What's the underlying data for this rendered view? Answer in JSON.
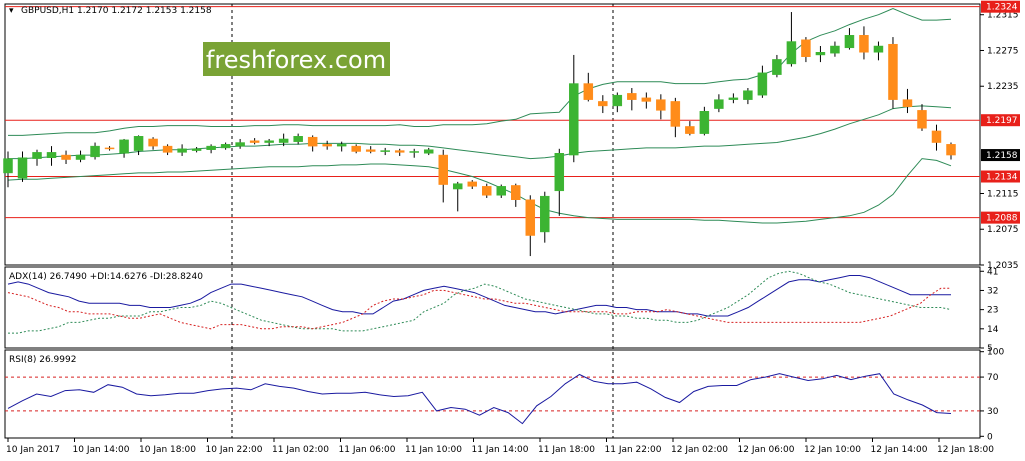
{
  "header": {
    "symbol_info": "GBPUSD,H1  1.2170 1.2172 1.2153 1.2158",
    "adx_info": "ADX(14) 26.7490 +DI:14.6276 -DI:28.8240",
    "rsi_info": "RSI(8) 26.9992"
  },
  "watermark": "freshforex.com",
  "colors": {
    "bull": "#3cb432",
    "bear": "#ff8c1a",
    "band": "#2e8b57",
    "level": "#e8201a",
    "adx": "#1a1aa0",
    "plus_di": "#2e8b57",
    "minus_di": "#d62020",
    "rsi": "#1a1aa0",
    "rsi_level": "#d62020",
    "current_tag": "#000000"
  },
  "chart_data": [
    {
      "type": "candlestick",
      "ylim": [
        1.2035,
        1.2327
      ],
      "y_ticks": [
        "1.2315",
        "1.2275",
        "1.2235",
        "1.2197",
        "1.2158",
        "1.2134",
        "1.2115",
        "1.2088",
        "1.2075",
        "1.2035"
      ],
      "price_tags": [
        {
          "value": "1.2324",
          "color": "level"
        },
        {
          "value": "1.2197",
          "color": "level"
        },
        {
          "value": "1.2158",
          "color": "current"
        },
        {
          "value": "1.2134",
          "color": "level"
        },
        {
          "value": "1.2088",
          "color": "level"
        }
      ],
      "levels": [
        1.2324,
        1.2197,
        1.2134,
        1.2088
      ],
      "current": 1.2158,
      "candles": [
        [
          1.2138,
          1.2162,
          1.2122,
          1.2154
        ],
        [
          1.2132,
          1.2162,
          1.2128,
          1.2155
        ],
        [
          1.2154,
          1.2164,
          1.2146,
          1.2161
        ],
        [
          1.2155,
          1.2168,
          1.2146,
          1.2161
        ],
        [
          1.2158,
          1.2163,
          1.2148,
          1.2153
        ],
        [
          1.2153,
          1.2163,
          1.215,
          1.2158
        ],
        [
          1.2156,
          1.2172,
          1.2153,
          1.2168
        ],
        [
          1.2166,
          1.2168,
          1.2163,
          1.2165
        ],
        [
          1.216,
          1.2176,
          1.2155,
          1.2175
        ],
        [
          1.2163,
          1.218,
          1.2158,
          1.2179
        ],
        [
          1.2176,
          1.2178,
          1.2164,
          1.2168
        ],
        [
          1.2168,
          1.217,
          1.2158,
          1.2161
        ],
        [
          1.2161,
          1.217,
          1.2157,
          1.2165
        ],
        [
          1.2163,
          1.2167,
          1.2161,
          1.2165
        ],
        [
          1.2164,
          1.217,
          1.216,
          1.2168
        ],
        [
          1.2166,
          1.2172,
          1.2164,
          1.217
        ],
        [
          1.2168,
          1.2176,
          1.2165,
          1.2172
        ],
        [
          1.2174,
          1.2177,
          1.217,
          1.2172
        ],
        [
          1.2172,
          1.2176,
          1.2168,
          1.2174
        ],
        [
          1.2172,
          1.2182,
          1.2168,
          1.2176
        ],
        [
          1.2173,
          1.2182,
          1.217,
          1.2179
        ],
        [
          1.2178,
          1.218,
          1.2162,
          1.2168
        ],
        [
          1.217,
          1.2174,
          1.2164,
          1.2168
        ],
        [
          1.2168,
          1.2173,
          1.2162,
          1.217
        ],
        [
          1.2168,
          1.217,
          1.216,
          1.2162
        ],
        [
          1.2164,
          1.2168,
          1.216,
          1.2162
        ],
        [
          1.2162,
          1.2166,
          1.2158,
          1.2163
        ],
        [
          1.2163,
          1.2165,
          1.2157,
          1.2161
        ],
        [
          1.2161,
          1.2165,
          1.2155,
          1.2162
        ],
        [
          1.216,
          1.2166,
          1.2158,
          1.2164
        ],
        [
          1.2158,
          1.2164,
          1.2105,
          1.2125
        ],
        [
          1.212,
          1.2128,
          1.2095,
          1.2126
        ],
        [
          1.2128,
          1.213,
          1.212,
          1.2123
        ],
        [
          1.2123,
          1.2126,
          1.211,
          1.2113
        ],
        [
          1.2113,
          1.2125,
          1.211,
          1.2123
        ],
        [
          1.2124,
          1.2126,
          1.21,
          1.2108
        ],
        [
          1.2108,
          1.2113,
          1.2045,
          1.2068
        ],
        [
          1.2072,
          1.2117,
          1.206,
          1.2112
        ],
        [
          1.2118,
          1.2165,
          1.209,
          1.216
        ],
        [
          1.2158,
          1.227,
          1.215,
          1.2238
        ],
        [
          1.2238,
          1.225,
          1.2218,
          1.222
        ],
        [
          1.2218,
          1.2225,
          1.2205,
          1.2213
        ],
        [
          1.2213,
          1.2228,
          1.2206,
          1.2225
        ],
        [
          1.2227,
          1.2233,
          1.2208,
          1.222
        ],
        [
          1.2222,
          1.2228,
          1.221,
          1.2218
        ],
        [
          1.222,
          1.2226,
          1.2198,
          1.2208
        ],
        [
          1.2218,
          1.2222,
          1.2178,
          1.219
        ],
        [
          1.219,
          1.2196,
          1.218,
          1.2182
        ],
        [
          1.2182,
          1.2212,
          1.218,
          1.2207
        ],
        [
          1.221,
          1.2226,
          1.2206,
          1.222
        ],
        [
          1.222,
          1.2227,
          1.2216,
          1.2222
        ],
        [
          1.222,
          1.2233,
          1.2215,
          1.223
        ],
        [
          1.2225,
          1.2258,
          1.2222,
          1.225
        ],
        [
          1.2248,
          1.227,
          1.2245,
          1.2265
        ],
        [
          1.226,
          1.2318,
          1.2257,
          1.2285
        ],
        [
          1.2287,
          1.229,
          1.2262,
          1.2268
        ],
        [
          1.227,
          1.228,
          1.2262,
          1.2273
        ],
        [
          1.2272,
          1.2285,
          1.2268,
          1.228
        ],
        [
          1.2278,
          1.23,
          1.2276,
          1.2292
        ],
        [
          1.2292,
          1.2302,
          1.2265,
          1.2273
        ],
        [
          1.2273,
          1.2285,
          1.2264,
          1.228
        ],
        [
          1.2282,
          1.229,
          1.221,
          1.222
        ],
        [
          1.222,
          1.2232,
          1.2205,
          1.2212
        ],
        [
          1.2208,
          1.2215,
          1.2185,
          1.2188
        ],
        [
          1.2185,
          1.2192,
          1.2163,
          1.2172
        ],
        [
          1.217,
          1.2172,
          1.2153,
          1.2158
        ]
      ],
      "bb_upper": [
        1.218,
        1.218,
        1.2181,
        1.2182,
        1.2183,
        1.2183,
        1.2183,
        1.2185,
        1.2188,
        1.219,
        1.219,
        1.2191,
        1.2191,
        1.2191,
        1.219,
        1.219,
        1.219,
        1.2191,
        1.2191,
        1.2192,
        1.2192,
        1.2191,
        1.2191,
        1.2191,
        1.2191,
        1.2191,
        1.2191,
        1.2192,
        1.219,
        1.219,
        1.2192,
        1.2192,
        1.2192,
        1.2193,
        1.2196,
        1.2198,
        1.2204,
        1.2205,
        1.2206,
        1.2224,
        1.2232,
        1.2237,
        1.224,
        1.224,
        1.224,
        1.224,
        1.2238,
        1.2238,
        1.2238,
        1.224,
        1.2242,
        1.2243,
        1.2248,
        1.2254,
        1.2272,
        1.2285,
        1.2292,
        1.2297,
        1.2304,
        1.231,
        1.2315,
        1.2322,
        1.2315,
        1.2309,
        1.2309,
        1.231
      ],
      "bb_middle": [
        1.2154,
        1.2154,
        1.2155,
        1.2156,
        1.2157,
        1.2158,
        1.2158,
        1.2159,
        1.216,
        1.2162,
        1.2163,
        1.2164,
        1.2164,
        1.2165,
        1.2166,
        1.2167,
        1.2168,
        1.2168,
        1.2169,
        1.217,
        1.217,
        1.2171,
        1.2171,
        1.2171,
        1.2171,
        1.217,
        1.217,
        1.2169,
        1.2169,
        1.2168,
        1.2166,
        1.2164,
        1.2162,
        1.216,
        1.2158,
        1.2156,
        1.2154,
        1.2155,
        1.2157,
        1.216,
        1.2162,
        1.2163,
        1.2164,
        1.2165,
        1.2166,
        1.2166,
        1.2166,
        1.2167,
        1.2168,
        1.2168,
        1.2169,
        1.217,
        1.2171,
        1.2172,
        1.2175,
        1.2178,
        1.2182,
        1.2187,
        1.2193,
        1.2198,
        1.2203,
        1.221,
        1.2212,
        1.2213,
        1.2212,
        1.2211
      ],
      "bb_lower": [
        1.213,
        1.2131,
        1.2131,
        1.2132,
        1.2133,
        1.2134,
        1.2135,
        1.2136,
        1.2137,
        1.2138,
        1.2138,
        1.2139,
        1.2139,
        1.214,
        1.2141,
        1.2142,
        1.2143,
        1.2144,
        1.2145,
        1.2145,
        1.2145,
        1.2146,
        1.2146,
        1.2147,
        1.2147,
        1.2148,
        1.2148,
        1.2147,
        1.2146,
        1.2145,
        1.2142,
        1.2138,
        1.2134,
        1.2128,
        1.2121,
        1.2114,
        1.2105,
        1.2097,
        1.2093,
        1.209,
        1.2088,
        1.2087,
        1.2086,
        1.2086,
        1.2086,
        1.2086,
        1.2086,
        1.2086,
        1.2085,
        1.2085,
        1.2084,
        1.2083,
        1.2082,
        1.2082,
        1.2083,
        1.2084,
        1.2086,
        1.2088,
        1.209,
        1.2094,
        1.2102,
        1.2114,
        1.2135,
        1.2154,
        1.2152,
        1.2146
      ]
    },
    {
      "type": "line",
      "ylim": [
        5,
        43
      ],
      "y_ticks": [
        "41",
        "32",
        "23",
        "14",
        "5"
      ],
      "series": [
        {
          "name": "ADX",
          "values": [
            35,
            36,
            35,
            33,
            31,
            30,
            29,
            27,
            26,
            26,
            26,
            26,
            25,
            25,
            24,
            24,
            24,
            25,
            26,
            28,
            31,
            33,
            35,
            35,
            34,
            33,
            32,
            31,
            30,
            29,
            27,
            25,
            23,
            22,
            22,
            21,
            21,
            24,
            27,
            28,
            30,
            32,
            33,
            34,
            33,
            32,
            31,
            29,
            27,
            25,
            24,
            23,
            22,
            22,
            21,
            22,
            23,
            24,
            25,
            25,
            24,
            24,
            23,
            23,
            22,
            22,
            22,
            21,
            21,
            20,
            20,
            20,
            22,
            24,
            27,
            30,
            33,
            36,
            37,
            37,
            36,
            37,
            38,
            39,
            39,
            38,
            36,
            34,
            32,
            30,
            30,
            30,
            30,
            30
          ]
        },
        {
          "name": "+DI",
          "values": [
            12,
            12,
            13,
            13,
            14,
            15,
            17,
            17,
            18,
            19,
            19,
            20,
            20,
            20,
            22,
            22,
            23,
            24,
            24,
            25,
            27,
            26,
            24,
            22,
            20,
            18,
            17,
            16,
            15,
            14,
            14,
            14,
            14,
            13,
            13,
            13,
            14,
            15,
            16,
            17,
            18,
            22,
            24,
            26,
            30,
            32,
            33,
            35,
            34,
            32,
            30,
            28,
            27,
            26,
            25,
            24,
            23,
            22,
            21,
            21,
            20,
            20,
            19,
            19,
            18,
            18,
            17,
            17,
            18,
            20,
            22,
            24,
            27,
            30,
            34,
            38,
            40,
            41,
            40,
            38,
            36,
            35,
            33,
            31,
            30,
            29,
            28,
            27,
            26,
            25,
            24,
            24,
            24,
            23
          ]
        },
        {
          "name": "-DI",
          "values": [
            31,
            30,
            29,
            27,
            25,
            24,
            22,
            22,
            21,
            21,
            21,
            20,
            19,
            19,
            20,
            21,
            19,
            17,
            16,
            15,
            14,
            16,
            16,
            16,
            15,
            14,
            14,
            15,
            15,
            15,
            14,
            15,
            16,
            17,
            19,
            21,
            25,
            27,
            28,
            28,
            29,
            30,
            32,
            32,
            31,
            30,
            29,
            28,
            28,
            27,
            26,
            26,
            25,
            24,
            23,
            22,
            22,
            22,
            22,
            22,
            21,
            21,
            22,
            22,
            22,
            23,
            22,
            21,
            20,
            19,
            18,
            17,
            17,
            17,
            17,
            17,
            17,
            17,
            17,
            17,
            17,
            17,
            17,
            17,
            17,
            18,
            19,
            20,
            22,
            24,
            26,
            30,
            33,
            33
          ]
        }
      ]
    },
    {
      "type": "line",
      "ylim": [
        -2,
        102
      ],
      "y_ticks": [
        "100",
        "70",
        "30",
        "0"
      ],
      "levels": [
        70,
        30
      ],
      "series": [
        {
          "name": "RSI",
          "values": [
            33,
            42,
            50,
            47,
            54,
            55,
            52,
            61,
            58,
            50,
            48,
            49,
            51,
            51,
            54,
            56,
            57,
            55,
            62,
            59,
            57,
            53,
            50,
            51,
            51,
            52,
            49,
            47,
            48,
            52,
            30,
            34,
            32,
            25,
            34,
            28,
            15,
            36,
            47,
            62,
            73,
            65,
            62,
            62,
            64,
            56,
            46,
            40,
            53,
            59,
            60,
            60,
            67,
            70,
            74,
            70,
            66,
            68,
            72,
            67,
            71,
            74,
            50,
            43,
            37,
            28,
            27
          ]
        }
      ]
    }
  ],
  "x_labels": [
    "10 Jan 2017",
    "10 Jan 14:00",
    "10 Jan 18:00",
    "10 Jan 22:00",
    "11 Jan 02:00",
    "11 Jan 06:00",
    "11 Jan 10:00",
    "11 Jan 14:00",
    "11 Jan 18:00",
    "11 Jan 22:00",
    "12 Jan 02:00",
    "12 Jan 06:00",
    "12 Jan 10:00",
    "12 Jan 14:00",
    "12 Jan 18:00"
  ]
}
